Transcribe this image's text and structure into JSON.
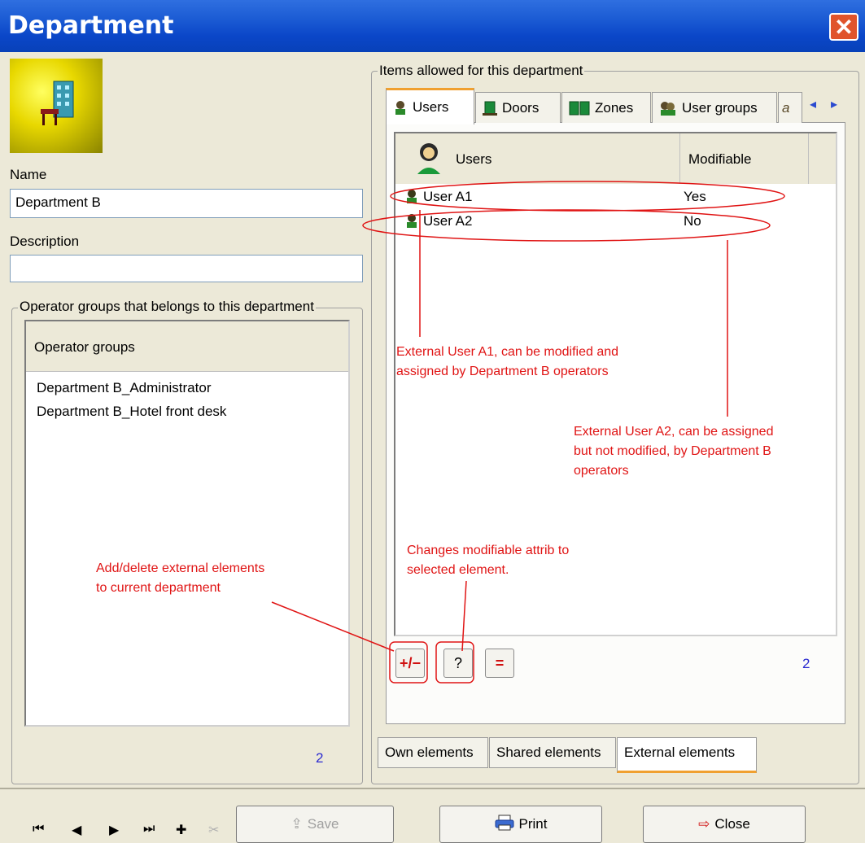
{
  "window": {
    "title": "Department",
    "close_symbol": "✕"
  },
  "left": {
    "name_label": "Name",
    "name_value": "Department B",
    "description_label": "Description",
    "description_value": "",
    "opgroups_legend": "Operator groups that belongs to this department",
    "opgroups_header": "Operator groups",
    "opgroups_items": [
      "Department B_Administrator",
      "Department B_Hotel front desk"
    ],
    "opgroups_count": "2"
  },
  "right": {
    "items_legend": "Items allowed for this department",
    "tabs": [
      "Users",
      "Doors",
      "Zones",
      "User groups",
      "a"
    ],
    "tab_scroll": [
      "◂",
      "▸"
    ],
    "columns": [
      "Users",
      "Modifiable"
    ],
    "rows": [
      {
        "user": "User A1",
        "modifiable": "Yes"
      },
      {
        "user": "User A2",
        "modifiable": "No"
      }
    ],
    "buttons": {
      "add_delete": "+/−",
      "modifiable": "?",
      "equal": "="
    },
    "count": "2",
    "bottom_tabs": [
      "Own elements",
      "Shared elements",
      "External elements"
    ]
  },
  "annotations": [
    "External User A1, can be modified and",
    "assigned by Department B operators",
    "External User A2, can be assigned",
    "but not modified, by Department B",
    "operators",
    "Changes modifiable attrib to",
    "selected element.",
    "Add/delete external elements",
    "to current department"
  ],
  "footer": {
    "nav": [
      "⏮",
      "◀",
      "▶",
      "⏭",
      "✚",
      "✂"
    ],
    "save_label": "Save",
    "print_label": "Print",
    "close_label": "Close"
  },
  "colors": {
    "titlebar": "#0a46c8",
    "annotation": "#e01414",
    "count": "#2a2ad0",
    "active_tab": "#f0a030"
  }
}
